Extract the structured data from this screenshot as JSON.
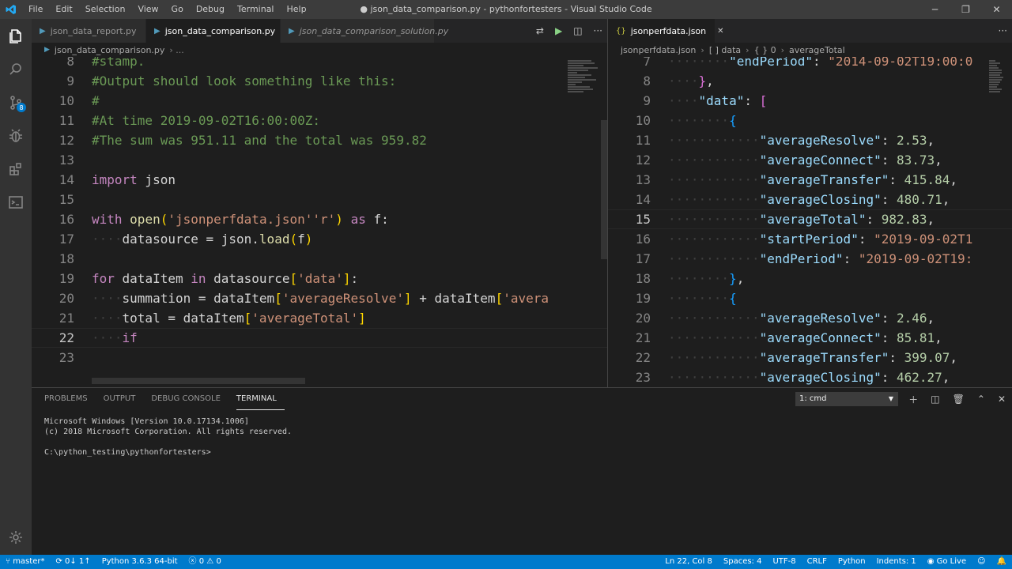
{
  "titlebar": {
    "menu": [
      "File",
      "Edit",
      "Selection",
      "View",
      "Go",
      "Debug",
      "Terminal",
      "Help"
    ],
    "title": "● json_data_comparison.py - pythonfortesters - Visual Studio Code"
  },
  "left_editor": {
    "tabs": [
      {
        "label": "json_data_report.py",
        "active": false
      },
      {
        "label": "json_data_comparison.py",
        "active": true,
        "dirty": true
      },
      {
        "label": "json_data_comparison_solution.py",
        "active": false
      }
    ],
    "breadcrumb": "json_data_comparison.py",
    "current_line": 22,
    "lines": [
      {
        "n": 8,
        "segs": [
          [
            "c",
            "#stamp."
          ]
        ]
      },
      {
        "n": 9,
        "segs": [
          [
            "c",
            "#Output should look something like this:"
          ]
        ]
      },
      {
        "n": 10,
        "segs": [
          [
            "c",
            "#"
          ]
        ]
      },
      {
        "n": 11,
        "segs": [
          [
            "c",
            "#At time 2019-09-02T16:00:00Z:"
          ]
        ]
      },
      {
        "n": 12,
        "segs": [
          [
            "c",
            "#The sum was 951.11 and the total was 959.82"
          ]
        ]
      },
      {
        "n": 13,
        "segs": []
      },
      {
        "n": 14,
        "segs": [
          [
            "k",
            "import"
          ],
          [
            "p",
            " json"
          ]
        ]
      },
      {
        "n": 15,
        "segs": []
      },
      {
        "n": 16,
        "segs": [
          [
            "k",
            "with"
          ],
          [
            "p",
            " "
          ],
          [
            "f",
            "open"
          ],
          [
            "b1",
            "("
          ],
          [
            "s",
            "'jsonperfdata.json'"
          ],
          [
            "s",
            "'r'"
          ],
          [
            "b1",
            ")"
          ],
          [
            "p",
            " "
          ],
          [
            "k",
            "as"
          ],
          [
            "p",
            " f:"
          ]
        ]
      },
      {
        "n": 17,
        "segs": [
          [
            "ws",
            "····"
          ],
          [
            "p",
            "datasource = json."
          ],
          [
            "f",
            "load"
          ],
          [
            "b1",
            "("
          ],
          [
            "p",
            "f"
          ],
          [
            "b1",
            ")"
          ]
        ]
      },
      {
        "n": 18,
        "segs": []
      },
      {
        "n": 19,
        "segs": [
          [
            "k",
            "for"
          ],
          [
            "p",
            " dataItem "
          ],
          [
            "k",
            "in"
          ],
          [
            "p",
            " datasource"
          ],
          [
            "b1",
            "["
          ],
          [
            "s",
            "'data'"
          ],
          [
            "b1",
            "]"
          ],
          [
            "p",
            ":"
          ]
        ]
      },
      {
        "n": 20,
        "segs": [
          [
            "ws",
            "····"
          ],
          [
            "p",
            "summation = dataItem"
          ],
          [
            "b1",
            "["
          ],
          [
            "s",
            "'averageResolve'"
          ],
          [
            "b1",
            "]"
          ],
          [
            "p",
            " + dataItem"
          ],
          [
            "b1",
            "["
          ],
          [
            "s",
            "'avera"
          ]
        ]
      },
      {
        "n": 21,
        "segs": [
          [
            "ws",
            "····"
          ],
          [
            "p",
            "total = dataItem"
          ],
          [
            "b1",
            "["
          ],
          [
            "s",
            "'averageTotal'"
          ],
          [
            "b1",
            "]"
          ]
        ]
      },
      {
        "n": 22,
        "segs": [
          [
            "ws",
            "····"
          ],
          [
            "k",
            "if"
          ],
          [
            "p",
            " "
          ]
        ]
      },
      {
        "n": 23,
        "segs": []
      }
    ]
  },
  "right_editor": {
    "tab": "jsonperfdata.json",
    "breadcrumb": [
      "jsonperfdata.json",
      "[ ] data",
      "{ } 0",
      "averageTotal"
    ],
    "current_line": 15,
    "lines": [
      {
        "n": 7,
        "segs": [
          [
            "ws",
            "········"
          ],
          [
            "v",
            "\"endPeriod\""
          ],
          [
            "p",
            ": "
          ],
          [
            "s",
            "\"2014-09-02T19:00:0"
          ]
        ]
      },
      {
        "n": 8,
        "segs": [
          [
            "ws",
            "····"
          ],
          [
            "b2",
            "}"
          ],
          [
            "p",
            ","
          ]
        ]
      },
      {
        "n": 9,
        "segs": [
          [
            "ws",
            "····"
          ],
          [
            "v",
            "\"data\""
          ],
          [
            "p",
            ": "
          ],
          [
            "b2",
            "["
          ]
        ]
      },
      {
        "n": 10,
        "segs": [
          [
            "ws",
            "········"
          ],
          [
            "b3",
            "{"
          ]
        ]
      },
      {
        "n": 11,
        "segs": [
          [
            "ws",
            "············"
          ],
          [
            "v",
            "\"averageResolve\""
          ],
          [
            "p",
            ": "
          ],
          [
            "n",
            "2.53"
          ],
          [
            "p",
            ","
          ]
        ]
      },
      {
        "n": 12,
        "segs": [
          [
            "ws",
            "············"
          ],
          [
            "v",
            "\"averageConnect\""
          ],
          [
            "p",
            ": "
          ],
          [
            "n",
            "83.73"
          ],
          [
            "p",
            ","
          ]
        ]
      },
      {
        "n": 13,
        "segs": [
          [
            "ws",
            "············"
          ],
          [
            "v",
            "\"averageTransfer\""
          ],
          [
            "p",
            ": "
          ],
          [
            "n",
            "415.84"
          ],
          [
            "p",
            ","
          ]
        ]
      },
      {
        "n": 14,
        "segs": [
          [
            "ws",
            "············"
          ],
          [
            "v",
            "\"averageClosing\""
          ],
          [
            "p",
            ": "
          ],
          [
            "n",
            "480.71"
          ],
          [
            "p",
            ","
          ]
        ]
      },
      {
        "n": 15,
        "segs": [
          [
            "ws",
            "············"
          ],
          [
            "v",
            "\"averageTotal\""
          ],
          [
            "p",
            ": "
          ],
          [
            "n",
            "982.83"
          ],
          [
            "p",
            ","
          ]
        ]
      },
      {
        "n": 16,
        "segs": [
          [
            "ws",
            "············"
          ],
          [
            "v",
            "\"startPeriod\""
          ],
          [
            "p",
            ": "
          ],
          [
            "s",
            "\"2019-09-02T1"
          ]
        ]
      },
      {
        "n": 17,
        "segs": [
          [
            "ws",
            "············"
          ],
          [
            "v",
            "\"endPeriod\""
          ],
          [
            "p",
            ": "
          ],
          [
            "s",
            "\"2019-09-02T19:"
          ]
        ]
      },
      {
        "n": 18,
        "segs": [
          [
            "ws",
            "········"
          ],
          [
            "b3",
            "}"
          ],
          [
            "p",
            ","
          ]
        ]
      },
      {
        "n": 19,
        "segs": [
          [
            "ws",
            "········"
          ],
          [
            "b3",
            "{"
          ]
        ]
      },
      {
        "n": 20,
        "segs": [
          [
            "ws",
            "············"
          ],
          [
            "v",
            "\"averageResolve\""
          ],
          [
            "p",
            ": "
          ],
          [
            "n",
            "2.46"
          ],
          [
            "p",
            ","
          ]
        ]
      },
      {
        "n": 21,
        "segs": [
          [
            "ws",
            "············"
          ],
          [
            "v",
            "\"averageConnect\""
          ],
          [
            "p",
            ": "
          ],
          [
            "n",
            "85.81"
          ],
          [
            "p",
            ","
          ]
        ]
      },
      {
        "n": 22,
        "segs": [
          [
            "ws",
            "············"
          ],
          [
            "v",
            "\"averageTransfer\""
          ],
          [
            "p",
            ": "
          ],
          [
            "n",
            "399.07"
          ],
          [
            "p",
            ","
          ]
        ]
      },
      {
        "n": 23,
        "segs": [
          [
            "ws",
            "············"
          ],
          [
            "v",
            "\"averageClosing\""
          ],
          [
            "p",
            ": "
          ],
          [
            "n",
            "462.27"
          ],
          [
            "p",
            ","
          ]
        ]
      }
    ]
  },
  "panel": {
    "tabs": [
      "PROBLEMS",
      "OUTPUT",
      "DEBUG CONSOLE",
      "TERMINAL"
    ],
    "active_tab": "TERMINAL",
    "terminal_select": "1: cmd",
    "terminal_lines": [
      "Microsoft Windows [Version 10.0.17134.1006]",
      "(c) 2018 Microsoft Corporation. All rights reserved.",
      "",
      "C:\\python_testing\\pythonfortesters>"
    ]
  },
  "statusbar": {
    "branch": "master*",
    "sync": "0↓ 1↑",
    "interpreter": "Python 3.6.3 64-bit",
    "errors": "0",
    "warnings": "0",
    "position": "Ln 22, Col 8",
    "spaces": "Spaces: 4",
    "encoding": "UTF-8",
    "eol": "CRLF",
    "language": "Python",
    "indents": "Indents: 1",
    "golive": "Go Live"
  },
  "activity_badges": {
    "scm": "8"
  },
  "colors": {
    "accent": "#007acc",
    "titlebar": "#3c3c3c",
    "editor_bg": "#1e1e1e"
  }
}
